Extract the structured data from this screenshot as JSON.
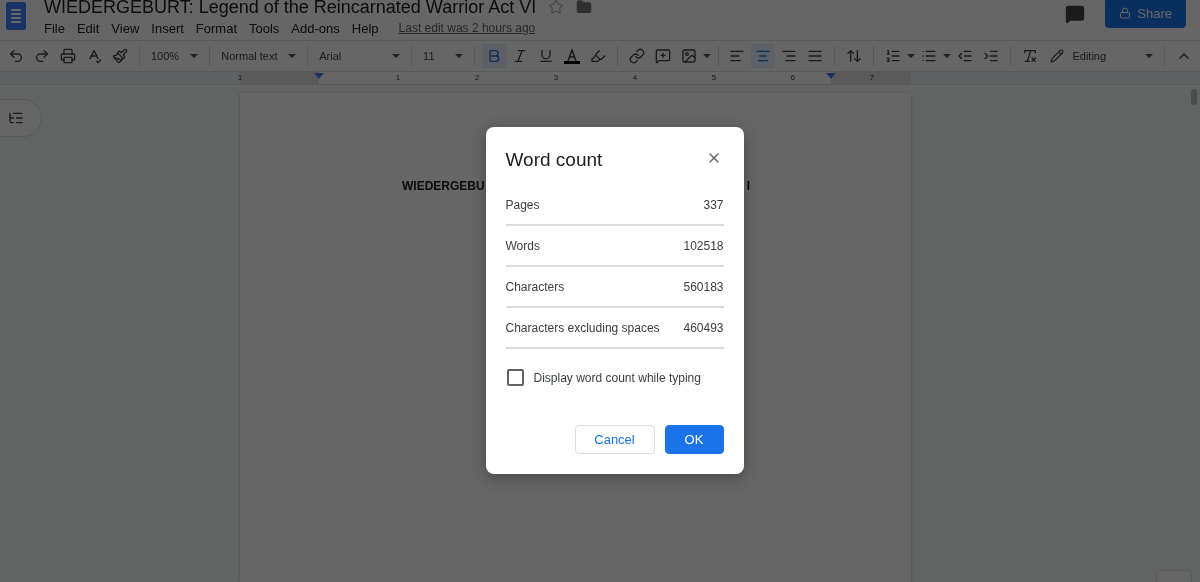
{
  "document": {
    "title": "WIEDERGEBURT: Legend of the Reincarnated Warrior Act VI",
    "starred": false
  },
  "menu": [
    "File",
    "Edit",
    "View",
    "Insert",
    "Format",
    "Tools",
    "Add-ons",
    "Help"
  ],
  "last_edit": "Last edit was 2 hours ago",
  "share_button": "Share",
  "toolbar": {
    "zoom": "100%",
    "style": "Normal text",
    "font": "Arial",
    "size": "11",
    "format_buttons": [
      {
        "selected": true
      },
      {
        "selected": false
      },
      {
        "selected": false
      }
    ],
    "align_buttons": [
      {
        "selected": false
      },
      {
        "selected": true
      },
      {
        "selected": false
      },
      {
        "selected": false
      }
    ],
    "mode": "Editing"
  },
  "ruler": [
    "1",
    "1",
    "2",
    "3",
    "4",
    "5",
    "6",
    "7"
  ],
  "doc_text": [
    "WIEDERGEBU",
    "I"
  ],
  "dialog": {
    "title": "Word count",
    "stats": [
      {
        "label": "Pages",
        "value": "337"
      },
      {
        "label": "Words",
        "value": "102518"
      },
      {
        "label": "Characters",
        "value": "560183"
      },
      {
        "label": "Characters excluding spaces",
        "value": "460493"
      }
    ],
    "checkbox": {
      "label": "Display word count while typing",
      "checked": false
    },
    "buttons": [
      {
        "label": "Cancel",
        "kind": "secondary"
      },
      {
        "label": "OK",
        "kind": "primary"
      }
    ]
  }
}
